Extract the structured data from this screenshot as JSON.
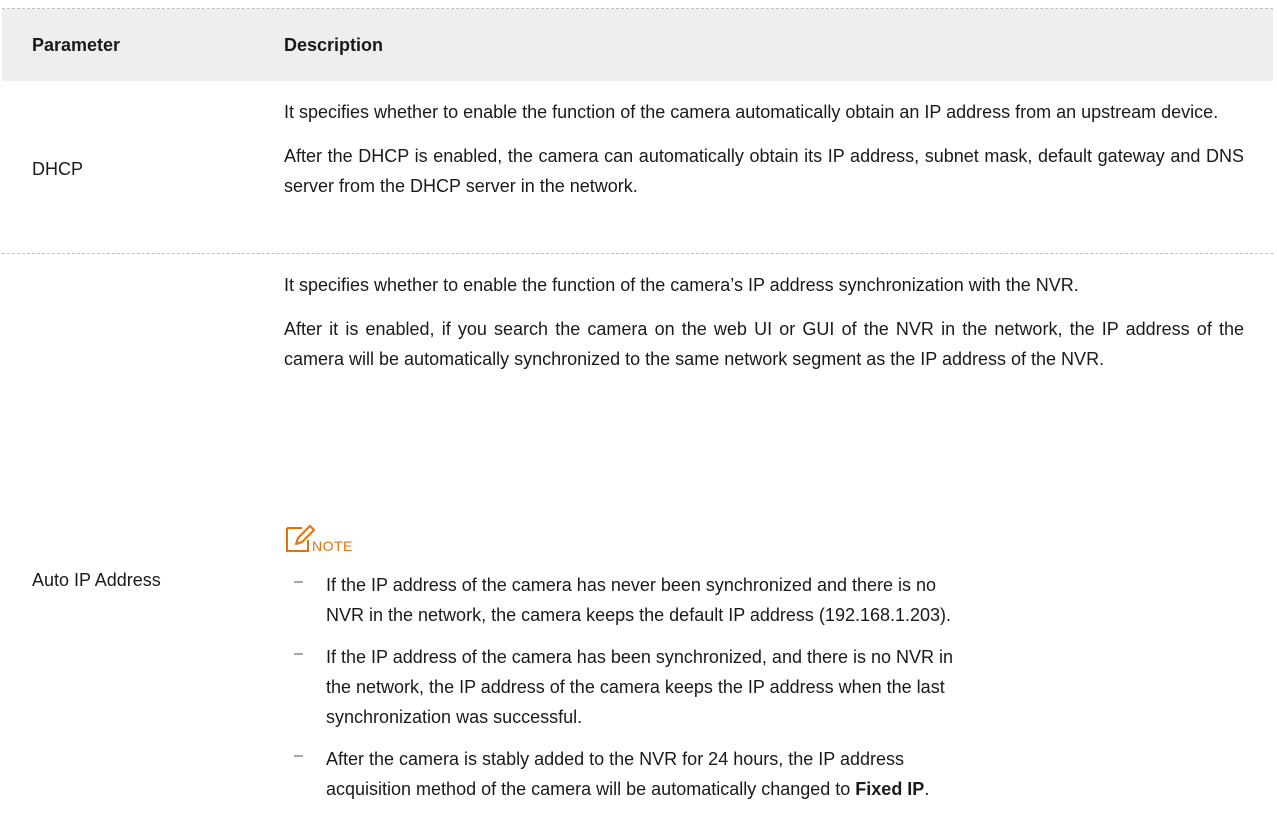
{
  "header": {
    "parameter": "Parameter",
    "description": "Description"
  },
  "rows": [
    {
      "parameter": "DHCP",
      "paragraphs": [
        "It specifies whether to enable the function of the camera automatically obtain an IP address from an upstream device.",
        "After the DHCP is enabled, the camera can automatically obtain its IP address, subnet mask, default gateway and DNS server from the DHCP server in the network."
      ]
    },
    {
      "parameter": "Auto IP Address",
      "paragraphs": [
        "It specifies whether to enable the function of the camera’s IP address synchronization with the NVR.",
        "After it is enabled, if you search the camera on the web UI or GUI of the NVR in the network, the IP address of the camera will be automatically synchronized to the same network segment as the IP address of the NVR."
      ],
      "note": {
        "label": "NOTE",
        "icon": "note-pencil-icon",
        "items": [
          "If the IP address of the camera has never been synchronized and there is no NVR in the network, the camera keeps the default IP address (192.168.1.203).",
          "If the IP address of the camera has been synchronized, and there is no NVR in the network, the IP address of the camera keeps the IP address when the last synchronization was successful.",
          "After the camera is stably added to the NVR for 24 hours, the IP address acquisition method of the camera will be automatically changed to "
        ],
        "last_item_bold": "Fixed IP",
        "last_item_end": "."
      }
    }
  ],
  "colors": {
    "header_bg": "#eeeeee",
    "note_accent": "#e8700a",
    "text": "#1a1a1a"
  }
}
